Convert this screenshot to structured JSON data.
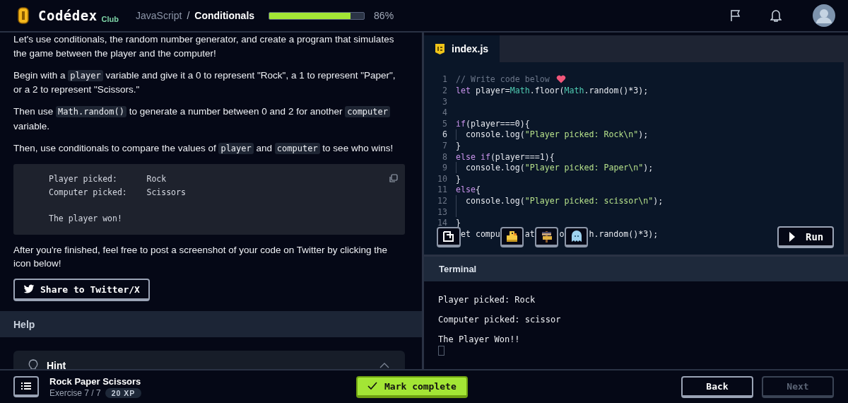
{
  "header": {
    "logo": {
      "wordmark": "Codédex",
      "tag": "Club"
    },
    "breadcrumb": [
      {
        "label": "JavaScript",
        "current": false
      },
      {
        "label": "/",
        "kind": "separator"
      },
      {
        "label": "Conditionals",
        "current": true
      }
    ],
    "progress": {
      "level": 0.86,
      "reading": "86%"
    }
  },
  "lesson": {
    "paragraphs": [
      [
        {
          "text": "Let's use conditionals, the random number generator, and create a program that simulates the game between the player and the computer!"
        }
      ],
      [
        {
          "text": "Begin with a "
        },
        {
          "text": "player",
          "code": true
        },
        {
          "text": " variable and give it a 0 to represent \"Rock\", a 1 to represent \"Paper\", or a 2 to represent \"Scissors.\""
        }
      ],
      [
        {
          "text": "Then use "
        },
        {
          "text": "Math.random()",
          "code": true
        },
        {
          "text": " to generate a number between 0 and 2 for another "
        },
        {
          "text": "computer",
          "code": true
        },
        {
          "text": " variable."
        }
      ],
      [
        {
          "text": "Then, use conditionals to compare the values of "
        },
        {
          "text": "player",
          "code": true
        },
        {
          "text": " and "
        },
        {
          "text": "computer",
          "code": true
        },
        {
          "text": " to see who wins!"
        }
      ]
    ],
    "example_output": [
      [
        "Player picked:      Rock",
        "Computer picked:    Scissors"
      ],
      [
        "The player won!"
      ]
    ],
    "closing": [
      {
        "text": "After you're finished, feel free to post a screenshot of your code on Twitter by clicking the icon below!"
      }
    ],
    "share_button": "Share to Twitter/X",
    "help": {
      "heading": "Help",
      "hint": {
        "label": "Hint",
        "expanded": true
      }
    }
  },
  "editor": {
    "tabs": [
      {
        "label": "index.js",
        "selected": true
      }
    ],
    "lines": [
      {
        "num": "1",
        "tokens": [
          {
            "kind": "comment",
            "text": "// Write code below "
          },
          {
            "kind": "heart"
          }
        ]
      },
      {
        "num": "2",
        "tokens": [
          {
            "kind": "keyword",
            "text": "let"
          },
          {
            "kind": "plain",
            "text": " player="
          },
          {
            "kind": "builtin",
            "text": "Math"
          },
          {
            "kind": "plain",
            "text": ".floor("
          },
          {
            "kind": "builtin",
            "text": "Math"
          },
          {
            "kind": "plain",
            "text": ".random()*3);"
          }
        ]
      },
      {
        "num": "3"
      },
      {
        "num": "4"
      },
      {
        "num": "5",
        "tokens": [
          {
            "kind": "keyword",
            "text": "if"
          },
          {
            "kind": "plain",
            "text": "(player===0){"
          }
        ]
      },
      {
        "num": "6",
        "active": true,
        "indent_guide": true,
        "tokens": [
          {
            "kind": "plain",
            "text": "console.log("
          },
          {
            "kind": "string",
            "text": "\"Player picked: Rock\\n\""
          },
          {
            "kind": "plain",
            "text": ");"
          }
        ]
      },
      {
        "num": "7",
        "tokens": [
          {
            "kind": "plain",
            "text": "}"
          }
        ]
      },
      {
        "num": "8",
        "tokens": [
          {
            "kind": "keyword",
            "text": "else if"
          },
          {
            "kind": "plain",
            "text": "(player===1){"
          }
        ]
      },
      {
        "num": "9",
        "indent_guide": true,
        "tokens": [
          {
            "kind": "plain",
            "text": "console.log("
          },
          {
            "kind": "string",
            "text": "\"Player picked: Paper\\n\""
          },
          {
            "kind": "plain",
            "text": ");"
          }
        ]
      },
      {
        "num": "10",
        "tokens": [
          {
            "kind": "plain",
            "text": "}"
          }
        ]
      },
      {
        "num": "11",
        "tokens": [
          {
            "kind": "keyword",
            "text": "else"
          },
          {
            "kind": "plain",
            "text": "{"
          }
        ]
      },
      {
        "num": "12",
        "indent_guide": true,
        "tokens": [
          {
            "kind": "plain",
            "text": "console.log("
          },
          {
            "kind": "string",
            "text": "\"Player picked: scissor\\n\""
          },
          {
            "kind": "plain",
            "text": ");"
          }
        ]
      },
      {
        "num": "13",
        "indent_guide": true
      },
      {
        "num": "14",
        "tokens": [
          {
            "kind": "plain",
            "text": "}"
          }
        ]
      },
      {
        "tokens": [
          {
            "kind": "fragment",
            "text": "et compu"
          },
          {
            "kind": "fragment",
            "text": "at"
          },
          {
            "kind": "fragment",
            "text": "o"
          },
          {
            "kind": "fragment",
            "text": "h.random()*3);"
          }
        ]
      }
    ],
    "toolbar": [
      {
        "kind": "copy"
      },
      {
        "kind": "duck"
      },
      {
        "kind": "signpost"
      },
      {
        "kind": "ghost"
      }
    ],
    "run_button": "Run"
  },
  "terminal": {
    "title": "Terminal",
    "lines": [
      "Player picked: Rock",
      "Computer picked: scissor",
      "The Player Won!!"
    ]
  },
  "footer": {
    "title": "Rock Paper Scissors",
    "exercise": "Exercise 7 / 7",
    "xp": "20 XP",
    "mark_complete": "Mark complete",
    "nav": [
      {
        "label": "Back",
        "disabled": false
      },
      {
        "label": "Next",
        "disabled": true
      }
    ]
  }
}
